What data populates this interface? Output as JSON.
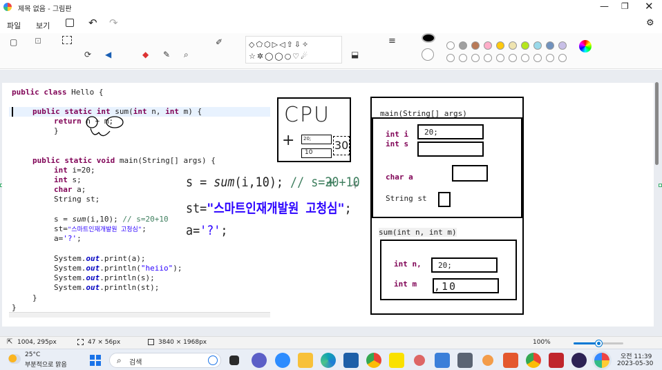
{
  "window": {
    "title": "제목 없음 - 그림판"
  },
  "menu": {
    "file": "파일",
    "view": "보기"
  },
  "code": {
    "l1_kw": "public class",
    "l1_name": " Hello {",
    "l2_kw": "public static int",
    "l2_rest": " sum(",
    "l2_p1t": "int",
    "l2_p1": " n, ",
    "l2_p2t": "int",
    "l2_p2": " m) {",
    "l3_kw": "return",
    "l3_rest": " n + m;",
    "l4": "}",
    "l5_kw": "public static void",
    "l5_rest": " main(String[] args) {",
    "l6_kw": "int",
    "l6_rest": " i=20;",
    "l7_kw": "int",
    "l7_rest": " s;",
    "l8_kw": "char",
    "l8_rest": " a;",
    "l9": "String st;",
    "l10_a": "s = ",
    "l10_b": "sum",
    "l10_c": "(i,10); ",
    "l10_cmt": "// s=20+10",
    "l11_a": "st=",
    "l11_str": "\"스마트인재개발원 고청심\"",
    "l11_b": ";",
    "l12_a": "a=",
    "l12_str": "'?'",
    "l12_b": ";",
    "sys": "System.",
    "out": "out",
    "l13_rest": ".print(a);",
    "l14_rest": ".println(",
    "l14_str": "\"heiio\"",
    "l14_end": ");",
    "l15_rest": ".println(s);",
    "l16_rest": ".println(st);",
    "close1": "}",
    "close2": "}"
  },
  "overlay": {
    "s_line_a": "s = ",
    "s_line_b": "sum",
    "s_line_c": "(i,10); ",
    "s_line_cmt": "// s=20+10",
    "st_line_a": "st=",
    "st_line_str": "\"스마트인재개발원 고청심\"",
    "st_line_b": ";",
    "a_line_a": "a=",
    "a_line_str": "'?'",
    "a_line_b": ";",
    "plus": "+"
  },
  "cpu": {
    "label": "CPU",
    "plus": "+",
    "small1": "20;",
    "small2": "10",
    "result": "30"
  },
  "main_frame": {
    "title": "main(String[] args)",
    "int_i": "int i",
    "int_i_val": "20;",
    "int_s": "int s",
    "char_a": "char a",
    "string_st": "String st"
  },
  "sum_frame": {
    "title": "sum(int n, int m)",
    "int_n": "int n,",
    "int_n_val": "20;",
    "int_m": "int m",
    "int_m_val": ",10"
  },
  "status": {
    "cursor": "1004, 295px",
    "selection": "47 × 56px",
    "canvas_size": "3840 × 1968px",
    "zoom": "100%",
    "zoom_level": 0.5
  },
  "taskbar": {
    "temp": "25°C",
    "weather": "부분적으로 맑음",
    "search": "검색",
    "time": "오전 11:39",
    "date": "2023-05-30"
  },
  "colors": {
    "row1": [
      "#ffffff",
      "#a0a0a0",
      "#b97a57",
      "#ffaec9",
      "#ffc90e",
      "#efe4b0",
      "#b5e61d",
      "#99d9ea",
      "#7092be",
      "#c8bfe7"
    ],
    "accent": "#0078d4"
  }
}
